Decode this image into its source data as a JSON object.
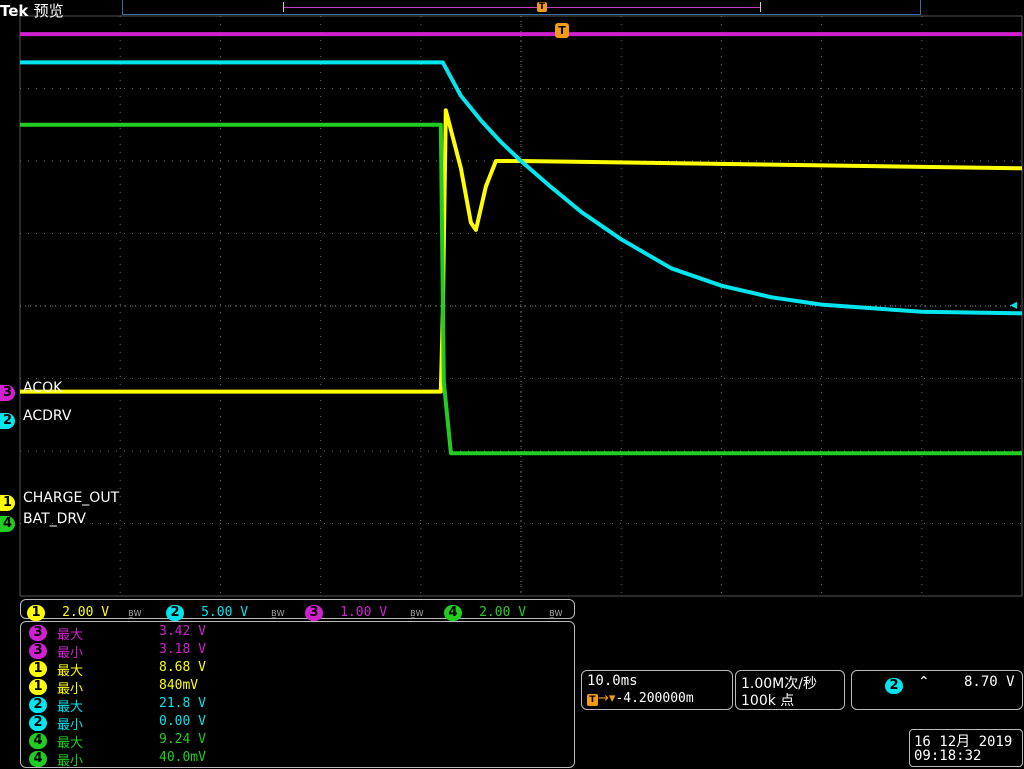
{
  "header": {
    "brand": "Tek",
    "mode": "预览"
  },
  "trigger_marker": "T",
  "channels": [
    {
      "id": "1",
      "name": "CHARGE_OUT",
      "scale": "2.00 V",
      "color": "#ffff00"
    },
    {
      "id": "2",
      "name": "ACDRV",
      "scale": "5.00 V",
      "color": "#00e5ee"
    },
    {
      "id": "3",
      "name": "ACOK",
      "scale": "1.00 V",
      "color": "#d020d0"
    },
    {
      "id": "4",
      "name": "BAT_DRV",
      "scale": "2.00 V",
      "color": "#22cc22"
    }
  ],
  "bw_label": "B̲W",
  "measurements": [
    {
      "ch": "3",
      "label": "最大",
      "value": "3.42 V",
      "color": "#d020d0"
    },
    {
      "ch": "3",
      "label": "最小",
      "value": "3.18 V",
      "color": "#d020d0"
    },
    {
      "ch": "1",
      "label": "最大",
      "value": "8.68 V",
      "color": "#ffff00"
    },
    {
      "ch": "1",
      "label": "最小",
      "value": "840mV",
      "color": "#ffff00"
    },
    {
      "ch": "2",
      "label": "最大",
      "value": "21.8 V",
      "color": "#00e5ee"
    },
    {
      "ch": "2",
      "label": "最小",
      "value": "0.00 V",
      "color": "#00e5ee"
    },
    {
      "ch": "4",
      "label": "最大",
      "value": "9.24 V",
      "color": "#22cc22"
    },
    {
      "ch": "4",
      "label": "最小",
      "value": "40.0mV",
      "color": "#22cc22"
    }
  ],
  "timebase": {
    "scale": "10.0ms",
    "delay": "-4.200000m"
  },
  "acquisition": {
    "rate": "1.00M次/秒",
    "points": "100k 点"
  },
  "trigger": {
    "source": "2",
    "slope": "falling",
    "level": "8.70 V"
  },
  "datetime": {
    "date": "16 12月 2019",
    "time": "09:18:32"
  },
  "chart_data": {
    "type": "line",
    "x_unit": "ms",
    "x_range": [
      -50,
      50
    ],
    "time_per_div": "10.0ms",
    "divisions": {
      "x": 10,
      "y": 8
    },
    "grid": true,
    "series": [
      {
        "name": "CHARGE_OUT",
        "channel": "1",
        "volts_per_div": 2.0,
        "x": [
          -50,
          -8,
          -7.8,
          -7.5,
          -6,
          -5,
          -4.5,
          -3.5,
          -2.5,
          0,
          50
        ],
        "y": [
          0.84,
          0.84,
          3.0,
          8.6,
          7.0,
          5.5,
          5.3,
          6.5,
          7.2,
          7.2,
          7.0
        ]
      },
      {
        "name": "ACDRV",
        "channel": "2",
        "volts_per_div": 5.0,
        "x": [
          -50,
          -7.8,
          -6,
          -4,
          -2,
          0,
          3,
          6,
          10,
          15,
          20,
          25,
          30,
          40,
          50
        ],
        "y": [
          21.8,
          21.8,
          19.5,
          17.8,
          16.3,
          15.0,
          13.2,
          11.5,
          9.6,
          7.6,
          6.4,
          5.6,
          5.1,
          4.6,
          4.5
        ]
      },
      {
        "name": "ACOK",
        "channel": "3",
        "volts_per_div": 1.0,
        "x": [
          -50,
          50
        ],
        "y": [
          3.3,
          3.3
        ]
      },
      {
        "name": "BAT_DRV",
        "channel": "4",
        "volts_per_div": 2.0,
        "x": [
          -50,
          -8,
          -7.7,
          -7,
          50
        ],
        "y": [
          9.1,
          9.1,
          2.0,
          0.04,
          0.04
        ]
      }
    ]
  }
}
